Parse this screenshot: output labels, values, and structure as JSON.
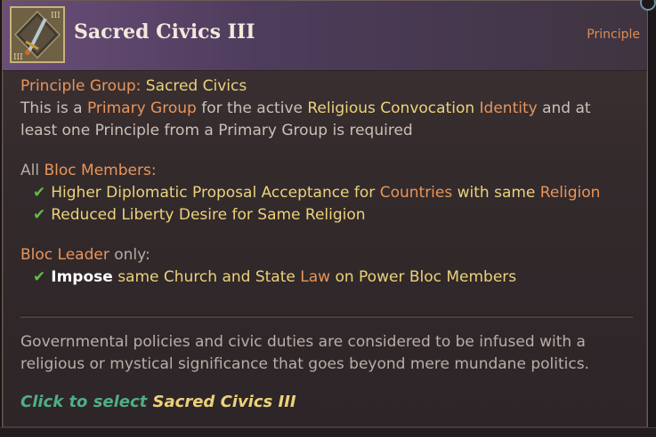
{
  "header": {
    "title": "Sacred Civics III",
    "category": "Principle",
    "badge_numeral": "III",
    "badge_icon": "dagger-icon"
  },
  "group_line": {
    "label": "Principle Group:",
    "value": "Sacred Civics"
  },
  "primary_line1": {
    "t1": "This is a ",
    "primary_group": "Primary Group",
    "t2": " for the active ",
    "religious_convocation": "Religious Convocation",
    "t3": " ",
    "identity": "Identity",
    "t4": " and at"
  },
  "primary_line2": "least one Principle from a Primary Group is required",
  "bloc_members": {
    "all": "All ",
    "label": "Bloc Members",
    "colon": ":",
    "item1": {
      "t1": "Higher Diplomatic Proposal Acceptance for ",
      "countries": "Countries",
      "t2": " with same ",
      "religion": "Religion"
    },
    "item2": "Reduced Liberty Desire for Same Religion"
  },
  "bloc_leader": {
    "label": "Bloc Leader",
    "only": " only:",
    "item1": {
      "impose": "Impose",
      "t1": " same Church and State ",
      "law": "Law",
      "t2": " on Power Bloc Members"
    }
  },
  "description": {
    "line1": "Governmental policies and civic duties are considered to be infused with a",
    "line2": "religious or mystical significance that goes beyond mere mundane politics."
  },
  "click": {
    "prefix": "Click to select ",
    "target": "Sacred Civics III"
  },
  "colors": {
    "yellow": "#ebd27a",
    "orange": "#e8955a",
    "green_check": "#5fbf42",
    "click_green": "#4fae87",
    "header_purple": "#6a4e79"
  }
}
